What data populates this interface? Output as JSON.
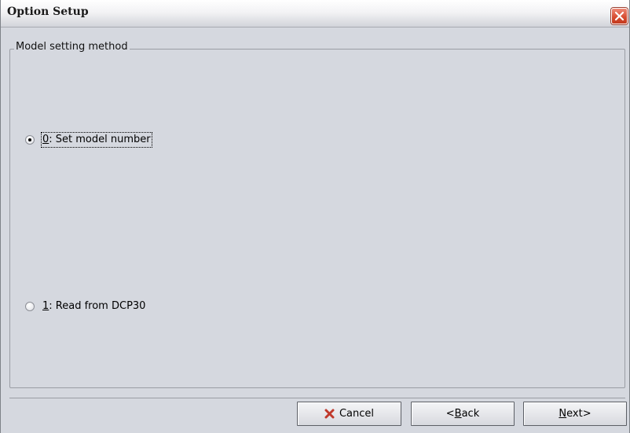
{
  "window": {
    "title": "Option Setup"
  },
  "group": {
    "legend": "Model setting method"
  },
  "options": [
    {
      "mnemonic": "0",
      "label_rest": ": Set model number",
      "checked": true
    },
    {
      "mnemonic": "1",
      "label_rest": ": Read from DCP30",
      "checked": false
    }
  ],
  "buttons": {
    "cancel": {
      "icon": "cancel-x-icon",
      "label": "Cancel"
    },
    "back": {
      "prefix": "<",
      "mnemonic": "B",
      "rest": "ack"
    },
    "next": {
      "mnemonic": "N",
      "rest": "ext>"
    }
  },
  "colors": {
    "background": "#d5d8df",
    "close_button": "#d64a2e",
    "cancel_icon": "#c0392b"
  }
}
